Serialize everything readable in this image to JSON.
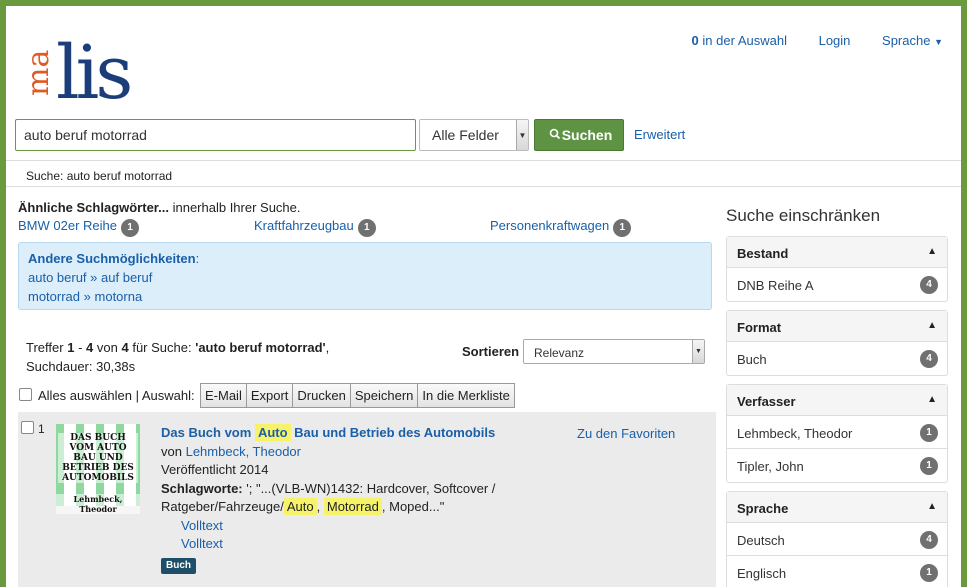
{
  "header": {
    "logo": {
      "part1": "ma",
      "part2": "lis"
    },
    "selection_count": "0",
    "selection_label": "in der Auswahl",
    "login": "Login",
    "language": "Sprache"
  },
  "search": {
    "query": "auto beruf motorrad",
    "field": "Alle Felder",
    "button": "Suchen",
    "advanced": "Erweitert"
  },
  "breadcrumb": "Suche: auto beruf motorrad",
  "similar": {
    "title_bold": "Ähnliche Schlagwörter...",
    "title_rest": " innerhalb Ihrer Suche.",
    "items": [
      {
        "label": "BMW 02er Reihe",
        "count": "1"
      },
      {
        "label": "Kraftfahrzeugbau",
        "count": "1"
      },
      {
        "label": "Personenkraftwagen",
        "count": "1"
      }
    ]
  },
  "alternatives": {
    "title": "Andere Suchmöglichkeiten",
    "rows": [
      {
        "from": "auto beruf",
        "arrow": "»",
        "to": "auf beruf"
      },
      {
        "from": "motorrad",
        "arrow": "»",
        "to": "motorna"
      }
    ]
  },
  "results": {
    "label_treffer": "Treffer",
    "from": "1",
    "dash": "-",
    "to": "4",
    "of_label": "von",
    "total": "4",
    "for_label": "für Suche:",
    "query_quoted": "'auto beruf motorrad'",
    "comma": ",",
    "duration_label": "Suchdauer:",
    "duration": "30,38s",
    "sort_label": "Sortieren",
    "sort_value": "Relevanz"
  },
  "bulk": {
    "select_all": "Alles auswählen",
    "sep": "|",
    "selection_label": "Auswahl:",
    "buttons": [
      "E-Mail",
      "Export",
      "Drucken",
      "Speichern",
      "In die Merkliste"
    ]
  },
  "result_item": {
    "index": "1",
    "cover_title": "DAS BUCH VOM AUTO BAU UND BETRIEB DES AUTOMOBILS",
    "cover_author": "Lehmbeck, Theodor",
    "title_pre": "Das Buch vom",
    "title_hl": "Auto",
    "title_post": "Bau und Betrieb des Automobils",
    "by_label": "von",
    "author": "Lehmbeck, Theodor",
    "published": "Veröffentlicht 2014",
    "subjects_label": "Schlagworte:",
    "subjects_1": "'; \"...(VLB-WN)1432: Hardcover, Softcover /",
    "subjects_2_pre": "Ratgeber/Fahrzeuge/",
    "subjects_hl1": "Auto",
    "subjects_mid": ",",
    "subjects_hl2": "Motorrad",
    "subjects_post": ", Moped...\"",
    "fulltext_1": "Volltext",
    "fulltext_2": "Volltext",
    "format": "Buch",
    "favorite": "Zu den Favoriten"
  },
  "sidebar": {
    "heading": "Suche einschränken",
    "facets": [
      {
        "title": "Bestand",
        "items": [
          {
            "label": "DNB Reihe A",
            "count": "4"
          }
        ]
      },
      {
        "title": "Format",
        "items": [
          {
            "label": "Buch",
            "count": "4"
          }
        ]
      },
      {
        "title": "Verfasser",
        "items": [
          {
            "label": "Lehmbeck, Theodor",
            "count": "1"
          },
          {
            "label": "Tipler, John",
            "count": "1"
          }
        ]
      },
      {
        "title": "Sprache",
        "items": [
          {
            "label": "Deutsch",
            "count": "4"
          },
          {
            "label": "Englisch",
            "count": "1"
          }
        ]
      }
    ]
  },
  "colors": {
    "accent": "#5f9344",
    "link": "#1a5fa8",
    "logo_red": "#e05a25",
    "logo_blue": "#1b3d7a"
  }
}
